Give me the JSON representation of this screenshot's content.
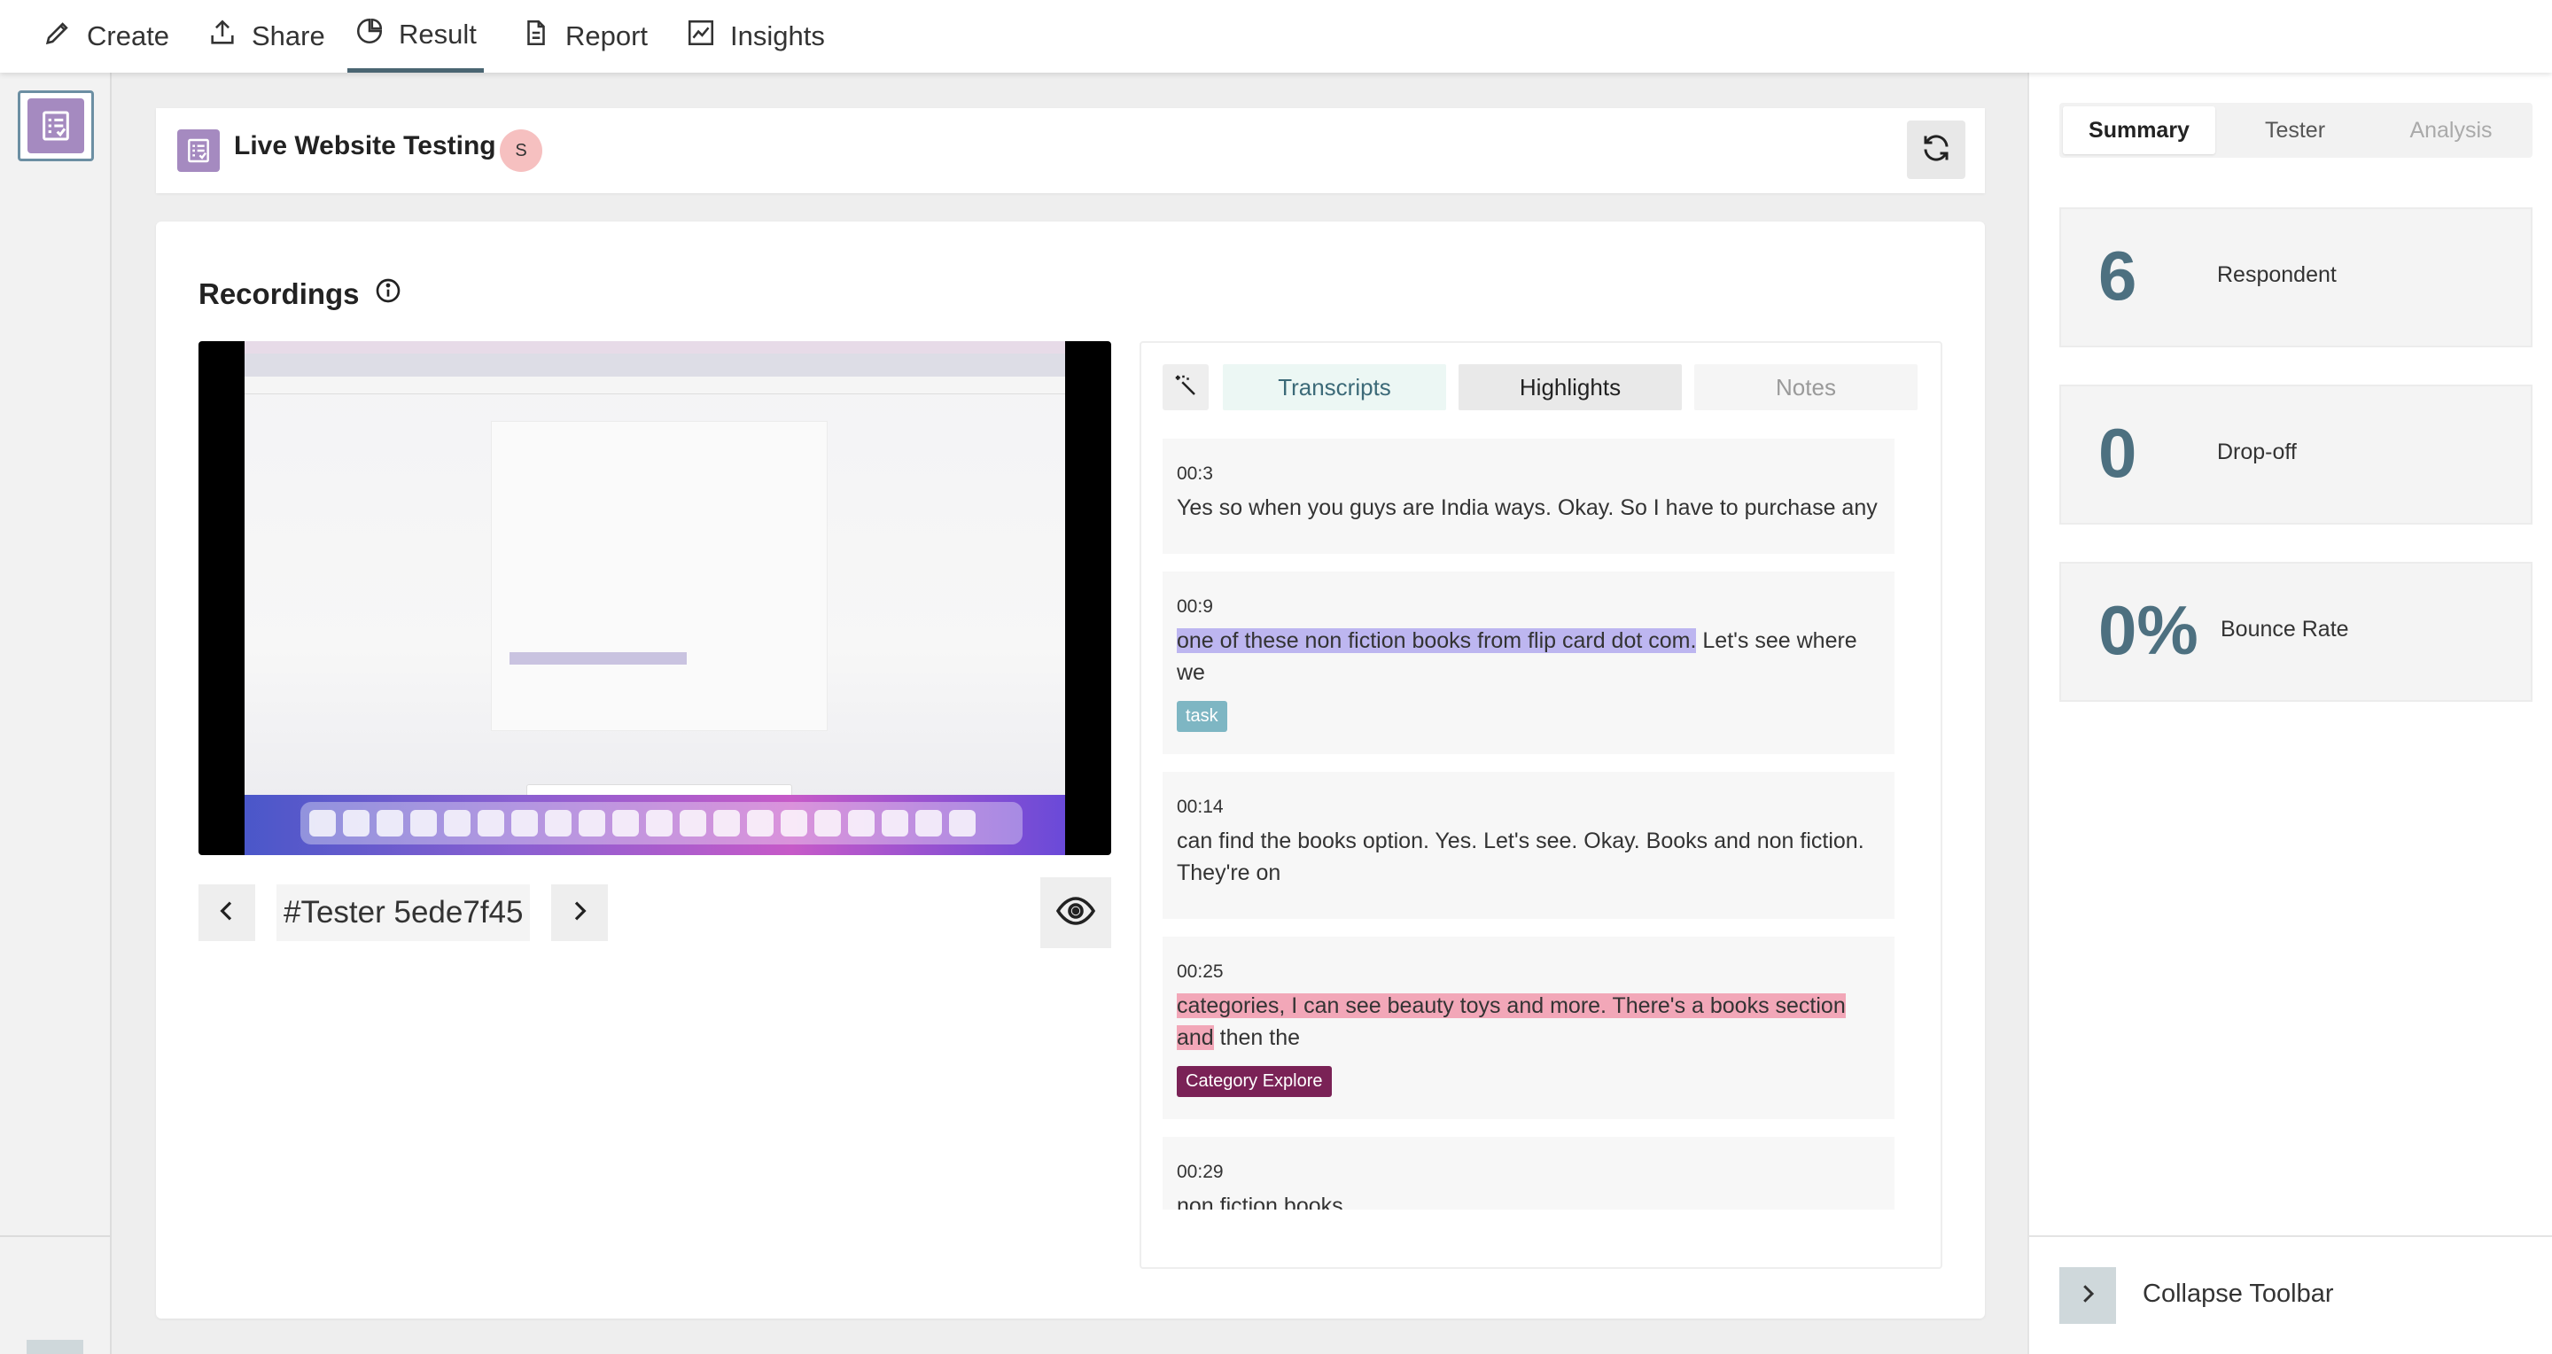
{
  "topnav": {
    "items": [
      {
        "label": "Create",
        "icon": "pencil-icon"
      },
      {
        "label": "Share",
        "icon": "share-upload-icon"
      },
      {
        "label": "Result",
        "icon": "pie-chart-icon",
        "active": true
      },
      {
        "label": "Report",
        "icon": "document-icon"
      },
      {
        "label": "Insights",
        "icon": "line-chart-icon"
      }
    ]
  },
  "header": {
    "title": "Live Website Testing",
    "avatar_initial": "S",
    "refresh_icon": "refresh-icon"
  },
  "recordings": {
    "title": "Recordings",
    "info_icon": "info-icon",
    "tester_label": "#Tester 5ede7f45"
  },
  "transcript_panel": {
    "tabs": [
      "Transcripts",
      "Highlights",
      "Notes"
    ],
    "entries": [
      {
        "time": "00:3",
        "text_highlighted": "",
        "text": "Yes so when you guys are India ways. Okay. So I have to purchase any",
        "tag": ""
      },
      {
        "time": "00:9",
        "text_highlighted": "one of these non fiction books from flip card dot com.",
        "text": " Let's see where we",
        "tag": "task"
      },
      {
        "time": "00:14",
        "text_highlighted": "",
        "text": "can find the books option. Yes. Let's see. Okay. Books and non fiction. They're on",
        "tag": ""
      },
      {
        "time": "00:25",
        "text_highlighted": "categories, I can see beauty toys and more. There's a books section and",
        "text": " then the",
        "tag": "Category Explore"
      },
      {
        "time": "00:29",
        "text_highlighted": "",
        "text": "non fiction books",
        "tag": ""
      }
    ],
    "colors": {
      "highlight_purple": "#bdb6f0",
      "highlight_pink": "#f2a7b8",
      "tag_teal": "#7eb6c3",
      "tag_plum": "#7a2256"
    }
  },
  "right_panel": {
    "tabs": [
      "Summary",
      "Tester",
      "Analysis"
    ],
    "stats": [
      {
        "value": "6",
        "label": "Respondent"
      },
      {
        "value": "0",
        "label": "Drop-off"
      },
      {
        "value": "0%",
        "label": "Bounce Rate"
      }
    ],
    "collapse_label": "Collapse Toolbar"
  },
  "accent_color": "#4d7080"
}
